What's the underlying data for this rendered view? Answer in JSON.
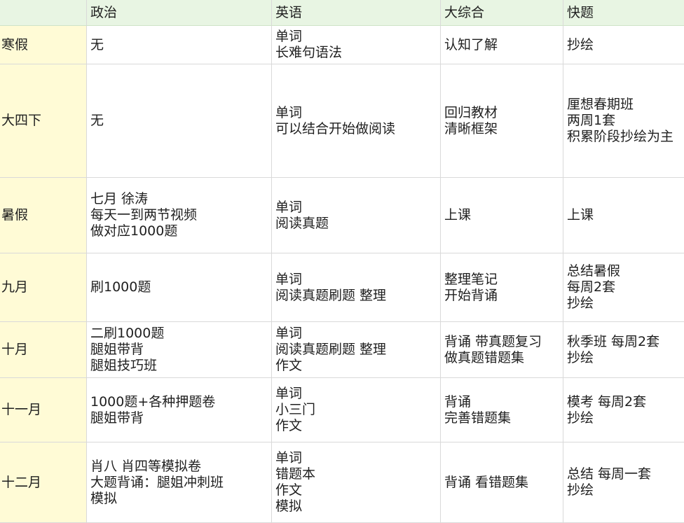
{
  "header": [
    "",
    "政治",
    "英语",
    "大综合",
    "快题"
  ],
  "rows": [
    {
      "label": "寒假",
      "cells": [
        [
          "无"
        ],
        [
          "单词",
          "长难句语法"
        ],
        [
          "认知了解"
        ],
        [
          "抄绘"
        ]
      ]
    },
    {
      "label": "大四下",
      "cells": [
        [
          "无"
        ],
        [
          "单词",
          "可以结合开始做阅读"
        ],
        [
          "回归教材",
          "清晰框架"
        ],
        [
          "厘想春期班",
          "两周1套",
          "积累阶段抄绘为主"
        ]
      ]
    },
    {
      "label": "暑假",
      "cells": [
        [
          "七月 徐涛",
          "每天一到两节视频",
          "做对应1000题"
        ],
        [
          "单词",
          "阅读真题"
        ],
        [
          "上课"
        ],
        [
          "上课"
        ]
      ]
    },
    {
      "label": "九月",
      "cells": [
        [
          "刷1000题"
        ],
        [
          "单词",
          "阅读真题刷题 整理"
        ],
        [
          "整理笔记",
          "开始背诵"
        ],
        [
          "总结暑假",
          "每周2套",
          "抄绘"
        ]
      ]
    },
    {
      "label": "十月",
      "cells": [
        [
          "二刷1000题",
          "腿姐带背",
          "腿姐技巧班"
        ],
        [
          "单词",
          "阅读真题刷题 整理",
          "作文"
        ],
        [
          "背诵 带真题复习",
          "做真题错题集"
        ],
        [
          "秋季班 每周2套",
          "抄绘"
        ]
      ]
    },
    {
      "label": "十一月",
      "cells": [
        [
          "1000题+各种押题卷",
          "腿姐带背"
        ],
        [
          "单词",
          "小三门",
          "作文"
        ],
        [
          "背诵",
          "完善错题集"
        ],
        [
          "模考 每周2套",
          "抄绘"
        ]
      ]
    },
    {
      "label": "十二月",
      "cells": [
        [
          "肖八 肖四等模拟卷",
          "大题背诵：腿姐冲刺班",
          "模拟"
        ],
        [
          "单词",
          "错题本",
          "作文",
          "模拟"
        ],
        [
          "背诵 看错题集"
        ],
        [
          "总结 每周一套",
          "抄绘"
        ]
      ]
    }
  ]
}
